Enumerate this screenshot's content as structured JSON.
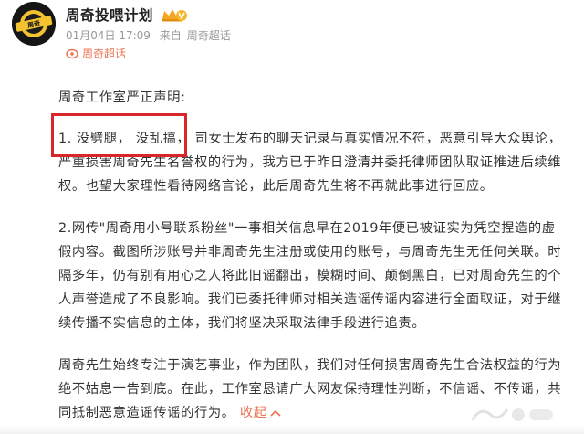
{
  "post": {
    "author": "周奇投喂计划",
    "date": "01月04日 17:09",
    "source_prefix": "来自",
    "source": "周奇超话",
    "topic": "周奇超话",
    "avatar_text": "周奇"
  },
  "statement": {
    "heading": "周奇工作室严正声明:",
    "p1": "1. 没劈腿，  没乱搞，  司女士发布的聊天记录与真实情况不符，恶意引导大众舆论，严重损害周奇先生名誉权的行为，我方已于昨日澄清并委托律师团队取证推进后续维权。也望大家理性看待网络言论，此后周奇先生将不再就此事进行回应。",
    "p2": "2.网传\"周奇用小号联系粉丝\"一事相关信息早在2019年便已被证实为凭空捏造的虚假内容。截图所涉账号并非周奇先生注册或使用的账号，与周奇先生无任何关联。时隔多年，仍有别有用心之人将此旧谣翻出，模糊时间、颠倒黑白，已对周奇先生的个人声誉造成了不良影响。我们已委托律师对相关造谣传谣内容进行全面取证，对于继续传播不实信息的主体，我们将坚决采取法律手段进行追责。",
    "p3": "周奇先生始终专注于演艺事业，作为团队，我们对任何损害周奇先生合法权益的行为绝不姑息一告到底。在此，工作室恳请广大网友保持理性判断，不信谣、不传谣，共同抵制恶意造谣传谣的行为。",
    "collapse_label": "收起"
  },
  "colors": {
    "accent": "#eb7350",
    "highlight_box": "#d8262b",
    "meta_text": "#999999",
    "body_text": "#333333"
  },
  "icons": {
    "badge": "crown-v-badge-icon",
    "topic": "super-topic-icon",
    "collapse": "chevron-up-icon"
  }
}
